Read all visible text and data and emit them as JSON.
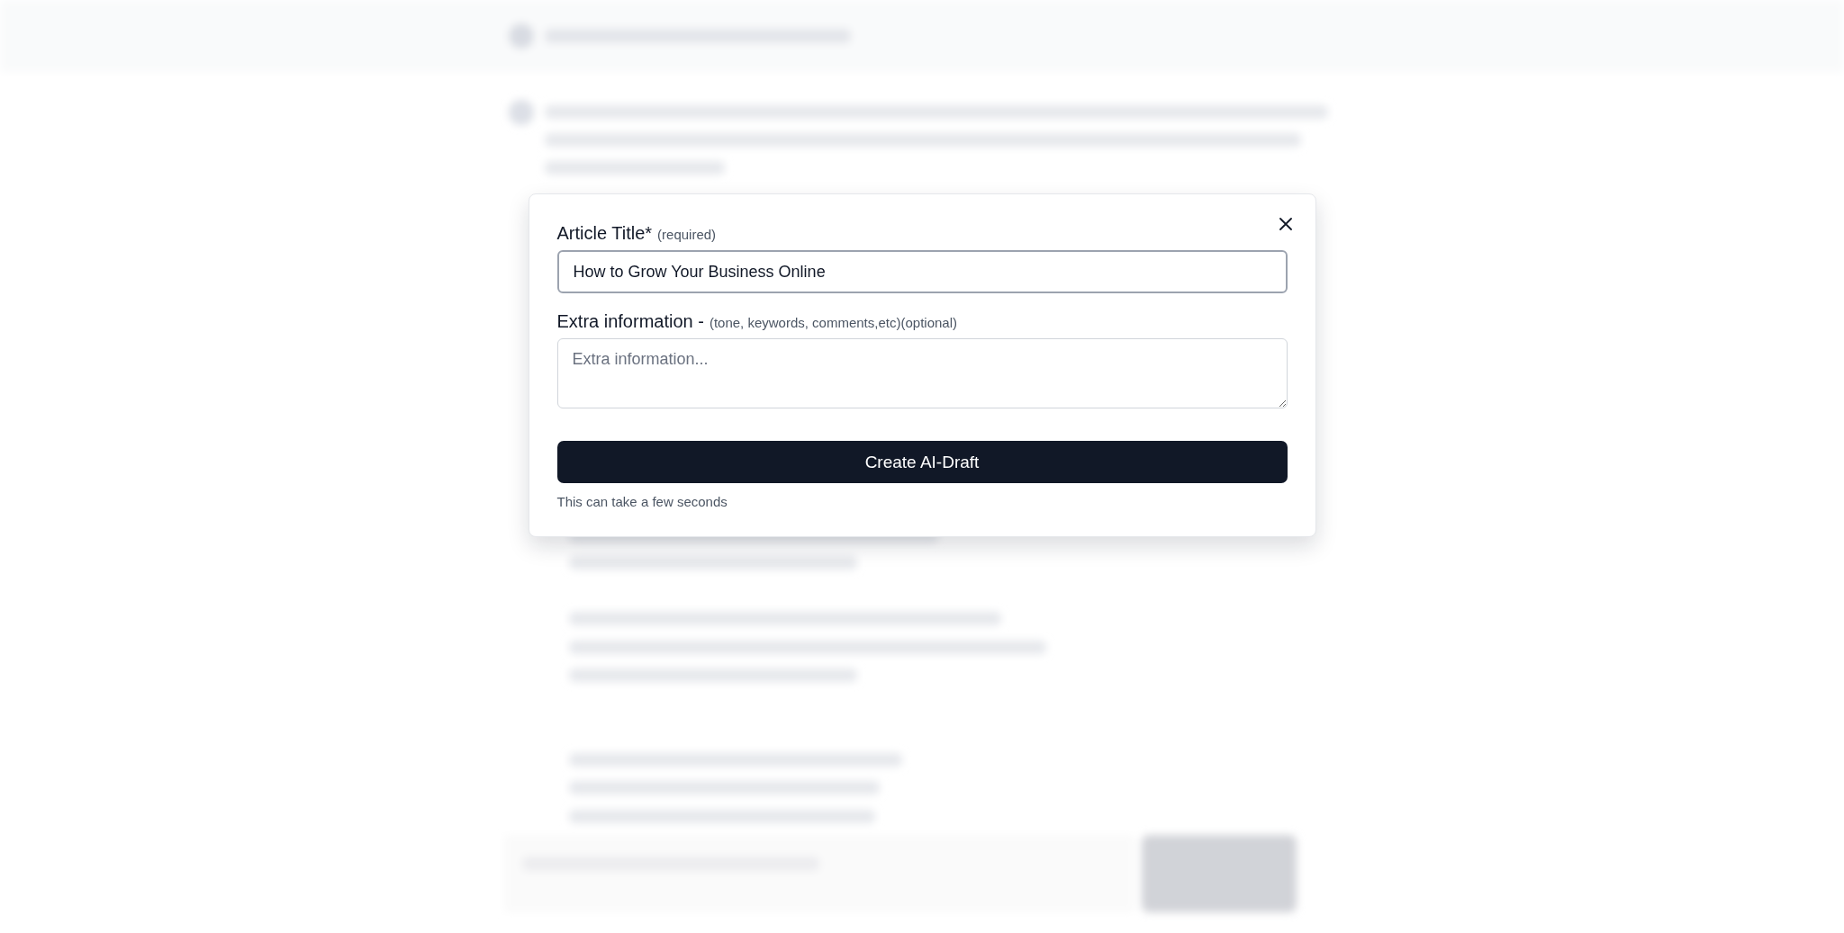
{
  "dialog": {
    "title_field": {
      "label": "Article Title*",
      "hint": "(required)",
      "value": "How to Grow Your Business Online"
    },
    "extra_field": {
      "label": "Extra information -",
      "hint": "(tone, keywords, comments,etc)(optional)",
      "placeholder": "Extra information..."
    },
    "submit_button": "Create AI-Draft",
    "note": "This can take a few seconds"
  }
}
